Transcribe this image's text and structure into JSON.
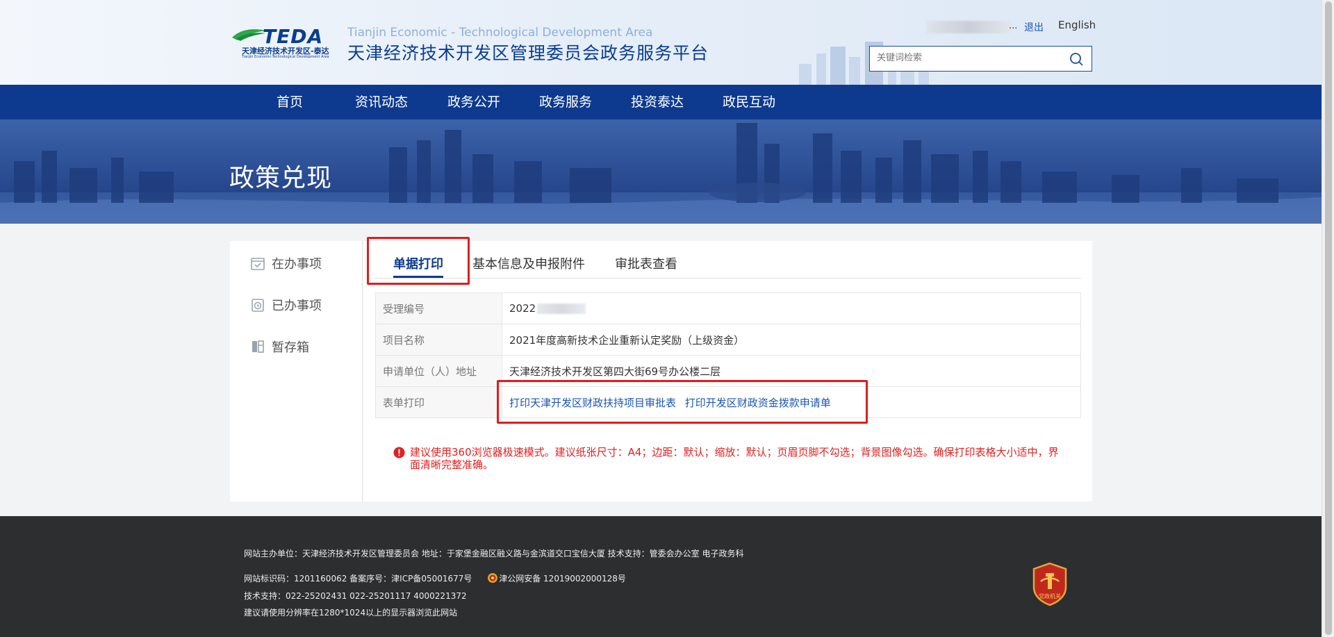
{
  "header": {
    "logo_text": "TEDA",
    "logo_cn": "天津经济技术开发区-泰达",
    "logo_en": "Tianjin Economic-Technological Development Area",
    "site_title_en": "Tianjin Economic - Technological Development Area",
    "site_title_cn": "天津经济技术开发区管理委员会政务服务平台",
    "user_ellipsis": "...",
    "logout_label": "退出",
    "english_label": "English",
    "search_placeholder": "关键词检索"
  },
  "nav": {
    "items": [
      {
        "label": "首页"
      },
      {
        "label": "资讯动态"
      },
      {
        "label": "政务公开"
      },
      {
        "label": "政务服务"
      },
      {
        "label": "投资泰达"
      },
      {
        "label": "政民互动"
      }
    ]
  },
  "banner": {
    "title": "政策兑现"
  },
  "sidebar": {
    "items": [
      {
        "label": "在办事项",
        "icon": "calendar-icon"
      },
      {
        "label": "已办事项",
        "icon": "clock-icon"
      },
      {
        "label": "暂存箱",
        "icon": "box-icon"
      }
    ]
  },
  "tabs": [
    {
      "label": "单据打印",
      "active": true
    },
    {
      "label": "基本信息及申报附件",
      "active": false
    },
    {
      "label": "审批表查看",
      "active": false
    }
  ],
  "info_table": {
    "rows": [
      {
        "label": "受理编号",
        "value": "2022"
      },
      {
        "label": "项目名称",
        "value": "2021年度高新技术企业重新认定奖励（上级资金）"
      },
      {
        "label": "申请单位（人）地址",
        "value": "天津经济技术开发区第四大街69号办公楼二层"
      },
      {
        "label": "表单打印",
        "value": ""
      }
    ],
    "print_links": [
      "打印天津开发区财政扶持项目审批表",
      "打印开发区财政资金拨款申请单"
    ]
  },
  "notice": "建议使用360浏览器极速模式。建议纸张尺寸：A4；边距：默认；缩放：默认；页眉页脚不勾选；背景图像勾选。确保打印表格大小适中，界面清晰完整准确。",
  "footer": {
    "line1": "网站主办单位：天津经济技术开发区管理委员会    地址：于家堡金融区融义路与金滨道交口宝信大厦    技术支持：管委会办公室 电子政务科",
    "line2_a": "网站标识码：1201160062     备案序号：津ICP备05001677号",
    "line2_b": "津公网安备 12019002000128号",
    "line3": "技术支持：022-25202431 022-25201117 4000221372",
    "line4": "建议请使用分辨率在1280*1024以上的显示器浏览此网站",
    "badge_text": "党政机关"
  },
  "colors": {
    "primary": "#0d3a8e",
    "link": "#1a56b0",
    "alert": "#e02020",
    "highlight_box": "#e31b1b",
    "footer_bg": "#2d2e30"
  }
}
